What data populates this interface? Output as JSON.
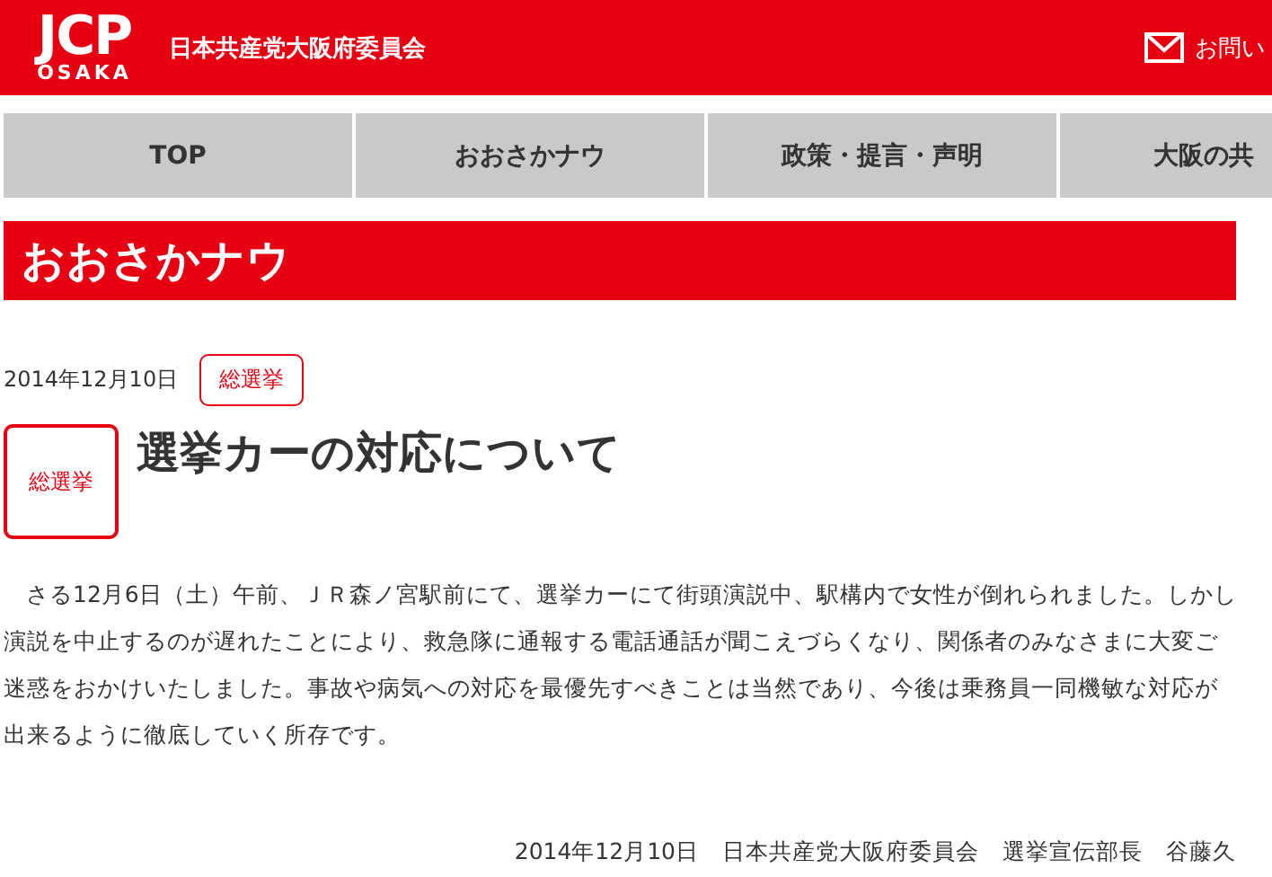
{
  "header": {
    "logo_main": "JCP",
    "logo_sub": "OSAKA",
    "site_title": "日本共産党大阪府委員会",
    "contact_link": "お問い"
  },
  "nav": [
    {
      "label": "TOP",
      "selected": false
    },
    {
      "label": "おおさかナウ",
      "selected": false
    },
    {
      "label": "政策・提言・声明",
      "selected": false
    },
    {
      "label": "大阪の共",
      "selected": false
    }
  ],
  "page_title": "おおさかナウ",
  "article": {
    "date": "2014年12月10日",
    "tag": "総選挙",
    "category": "総選挙",
    "title": "選挙カーの対応について",
    "body": "さる12月6日（土）午前、ＪＲ森ノ宮駅前にて、選挙カーにて街頭演説中、駅構内で女性が倒れられました。しかし演説を中止するのが遅れたことにより、救急隊に通報する電話通話が聞こえづらくなり、関係者のみなさまに大変ご迷惑をおかけいたしました。事故や病気への対応を最優先すべきことは当然であり、今後は乗務員一同機敏な対応が出来るように徹底していく所存です。",
    "signature": "2014年12月10日　日本共産党大阪府委員会　選挙宣伝部長　谷藤久"
  }
}
